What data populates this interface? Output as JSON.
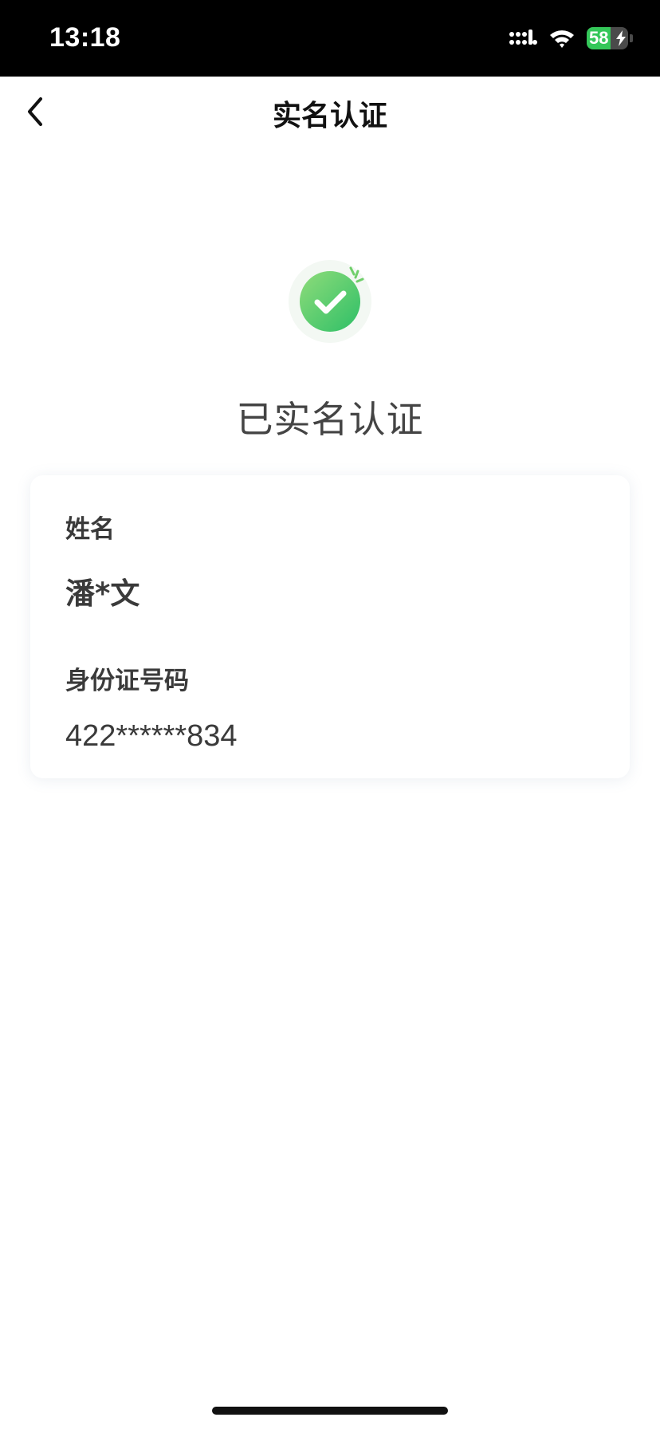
{
  "status_bar": {
    "time": "13:18",
    "battery_level": "58",
    "battery_fraction": 0.58,
    "battery_color": "#34c759",
    "icons": [
      "signal-icon",
      "wifi-icon",
      "battery-icon",
      "charging-bolt-icon"
    ]
  },
  "nav": {
    "title": "实名认证",
    "back_icon": "chevron-left-icon"
  },
  "status": {
    "icon": "check-circle-icon",
    "accent_color": "#3cc26b",
    "message": "已实名认证"
  },
  "card": {
    "name_label": "姓名",
    "name_value": "潘*文",
    "id_label": "身份证号码",
    "id_value": "422******834"
  }
}
